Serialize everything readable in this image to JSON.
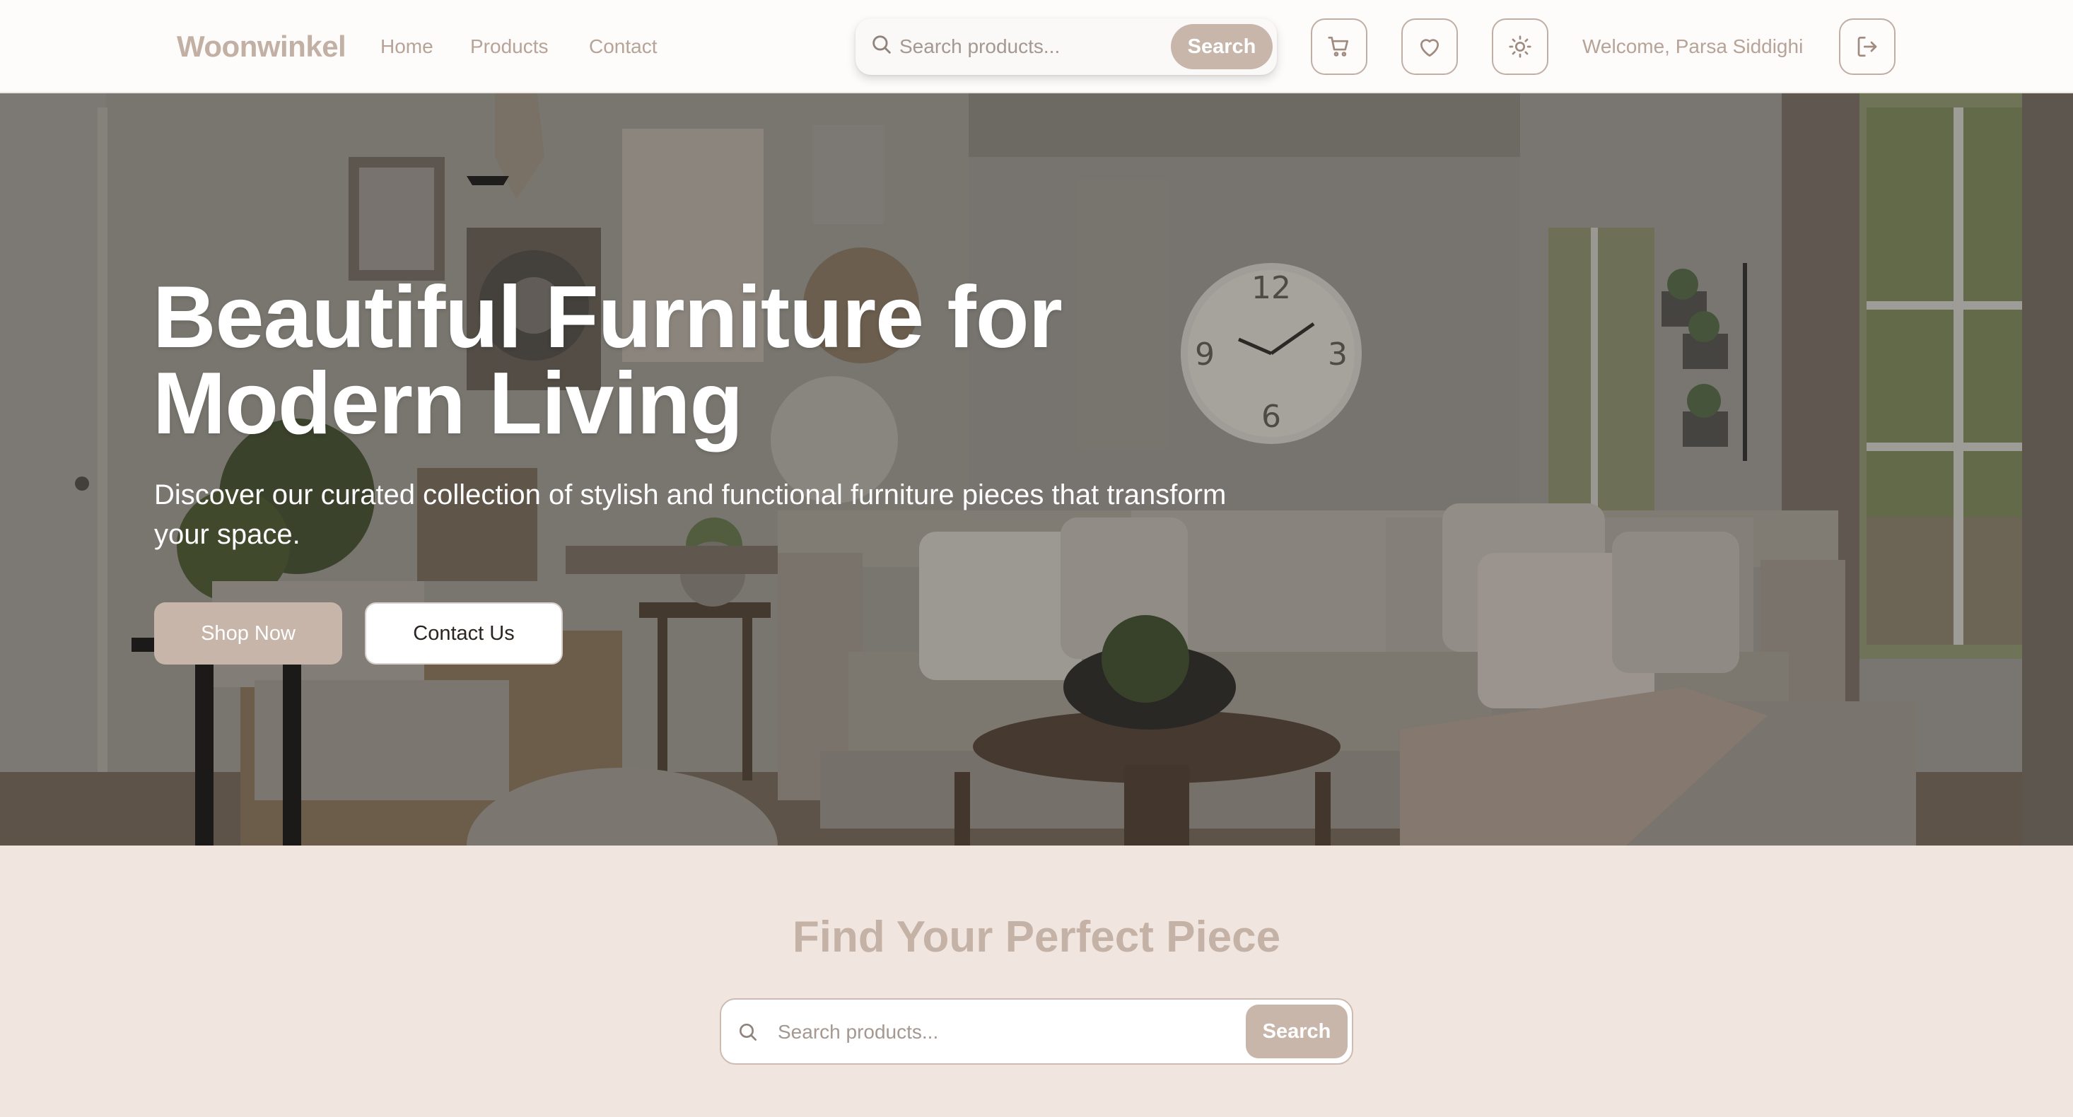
{
  "header": {
    "brand": "Woonwinkel",
    "nav": {
      "home": "Home",
      "products": "Products",
      "contact": "Contact"
    },
    "search": {
      "placeholder": "Search products...",
      "button": "Search"
    },
    "icons": {
      "cart": "cart-icon",
      "favorites": "heart-icon",
      "theme": "sun-icon",
      "logout": "logout-icon"
    },
    "welcome": "Welcome, Parsa Siddighi"
  },
  "hero": {
    "title_line1": "Beautiful Furniture for",
    "title_line2": "Modern Living",
    "subtitle": "Discover our curated collection of stylish and functional furniture pieces that transform your space.",
    "shop_button": "Shop Now",
    "contact_button": "Contact Us",
    "clock_numerals": [
      "12",
      "3",
      "6",
      "9"
    ]
  },
  "find": {
    "title": "Find Your Perfect Piece",
    "search": {
      "placeholder": "Search products...",
      "button": "Search"
    }
  },
  "colors": {
    "accent": "#c8b6ab",
    "nav_text": "#b7a398",
    "section_bg": "#f0e6df",
    "navbar_bg": "#fdfcfb"
  }
}
